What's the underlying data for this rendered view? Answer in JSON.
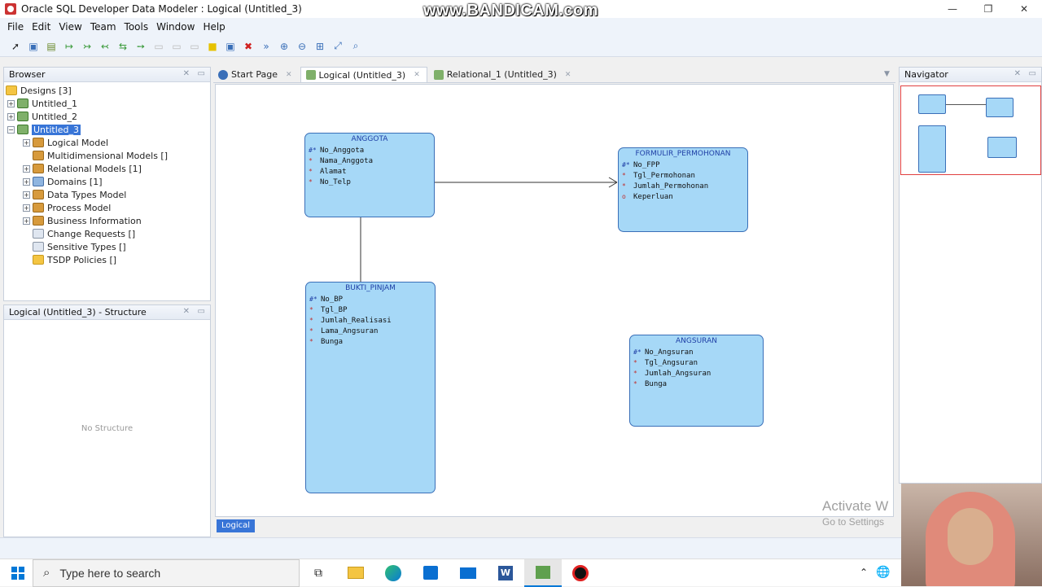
{
  "window": {
    "title": "Oracle SQL Developer Data Modeler : Logical (Untitled_3)",
    "watermark": "www.BANDICAM.com",
    "controls": [
      "—",
      "❐",
      "✕"
    ]
  },
  "menu": [
    "File",
    "Edit",
    "View",
    "Team",
    "Tools",
    "Window",
    "Help"
  ],
  "toolbar_icons": [
    "select-icon",
    "new-entity-icon",
    "new-view-icon",
    "relation-1-1-icon",
    "relation-1-n-icon",
    "relation-n-1-icon",
    "relation-m-n-icon",
    "arc-icon",
    "note-icon",
    "picture-icon",
    "folder-icon",
    "delete-icon",
    "engineer-icon",
    "zoom-in-icon",
    "zoom-out-icon",
    "fit-icon",
    "default-size-icon",
    "find-icon"
  ],
  "browser": {
    "title": "Browser",
    "items": [
      {
        "label": "Designs [3]",
        "level": 0
      },
      {
        "label": "Untitled_1",
        "level": 1
      },
      {
        "label": "Untitled_2",
        "level": 1
      },
      {
        "label": "Untitled_3",
        "level": 1,
        "selected": true
      },
      {
        "label": "Logical Model",
        "level": 2
      },
      {
        "label": "Multidimensional Models []",
        "level": 2
      },
      {
        "label": "Relational Models [1]",
        "level": 2
      },
      {
        "label": "Domains [1]",
        "level": 2
      },
      {
        "label": "Data Types Model",
        "level": 2
      },
      {
        "label": "Process Model",
        "level": 2
      },
      {
        "label": "Business Information",
        "level": 2
      },
      {
        "label": "Change Requests []",
        "level": 2
      },
      {
        "label": "Sensitive Types []",
        "level": 2
      },
      {
        "label": "TSDP Policies []",
        "level": 2
      }
    ]
  },
  "structure": {
    "title": "Logical (Untitled_3) - Structure",
    "empty": "No Structure"
  },
  "tabs": [
    {
      "label": "Start Page"
    },
    {
      "label": "Logical (Untitled_3)",
      "active": true
    },
    {
      "label": "Relational_1 (Untitled_3)"
    }
  ],
  "entities": [
    {
      "name": "ANGGOTA",
      "attrs": [
        {
          "mark": "#*",
          "name": "No_Anggota"
        },
        {
          "mark": "*",
          "name": "Nama_Anggota"
        },
        {
          "mark": "*",
          "name": "Alamat"
        },
        {
          "mark": "*",
          "name": "No_Telp"
        }
      ]
    },
    {
      "name": "FORMULIR_PERMOHONAN",
      "attrs": [
        {
          "mark": "#*",
          "name": "No_FPP"
        },
        {
          "mark": "*",
          "name": "Tgl_Permohonan"
        },
        {
          "mark": "*",
          "name": "Jumlah_Permohonan"
        },
        {
          "mark": "o",
          "name": "Keperluan"
        }
      ]
    },
    {
      "name": "BUKTI_PINJAM",
      "attrs": [
        {
          "mark": "#*",
          "name": "No_BP"
        },
        {
          "mark": "*",
          "name": "Tgl_BP"
        },
        {
          "mark": "*",
          "name": "Jumlah_Realisasi"
        },
        {
          "mark": "*",
          "name": "Lama_Angsuran"
        },
        {
          "mark": "*",
          "name": "Bunga"
        }
      ]
    },
    {
      "name": "ANGSURAN",
      "attrs": [
        {
          "mark": "#*",
          "name": "No_Angsuran"
        },
        {
          "mark": "*",
          "name": "Tgl_Angsuran"
        },
        {
          "mark": "*",
          "name": "Jumlah_Angsuran"
        },
        {
          "mark": "*",
          "name": "Bunga"
        }
      ]
    }
  ],
  "navigator": {
    "title": "Navigator"
  },
  "status_tab": "Logical",
  "activation": {
    "line1": "Activate W",
    "line2": "Go to Settings"
  },
  "taskbar": {
    "search_placeholder": "Type here to search"
  },
  "colors": {
    "entity_fill": "#a6d8f7",
    "entity_border": "#3a6fb8",
    "selection": "#3875d7"
  }
}
